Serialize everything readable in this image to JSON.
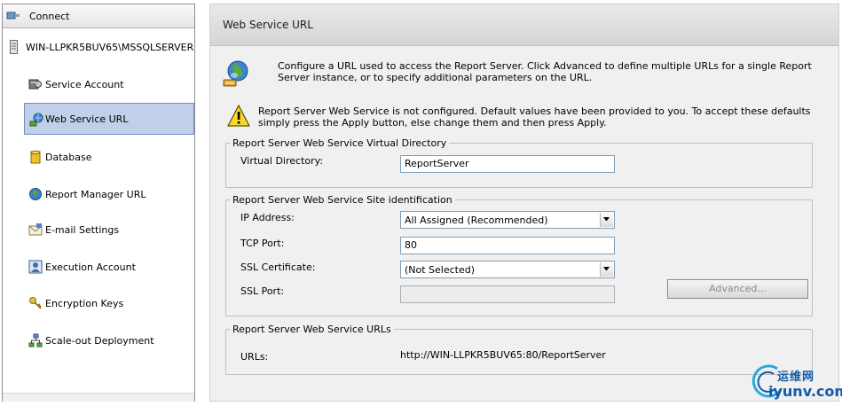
{
  "nav": {
    "connect_label": "Connect",
    "server_label": "WIN-LLPKR5BUV65\\MSSQLSERVER",
    "items": [
      {
        "label": "Service Account",
        "icon": "service-account-icon"
      },
      {
        "label": "Web Service URL",
        "icon": "web-service-url-icon",
        "selected": true
      },
      {
        "label": "Database",
        "icon": "database-icon"
      },
      {
        "label": "Report Manager URL",
        "icon": "globe-icon"
      },
      {
        "label": "E-mail Settings",
        "icon": "envelope-icon"
      },
      {
        "label": "Execution Account",
        "icon": "user-account-icon"
      },
      {
        "label": "Encryption Keys",
        "icon": "keys-icon"
      },
      {
        "label": "Scale-out Deployment",
        "icon": "network-icon"
      }
    ]
  },
  "page": {
    "title": "Web Service URL",
    "intro": "Configure a URL used to access the Report Server.  Click Advanced to define multiple URLs for a single Report Server instance, or to specify additional parameters on the URL.",
    "warning": "Report Server Web Service is not configured. Default values have been provided to you. To accept these defaults simply press the Apply button, else change them and then press Apply."
  },
  "virtual_directory": {
    "legend": "Report Server Web Service Virtual Directory",
    "label": "Virtual Directory:",
    "value": "ReportServer"
  },
  "site_identification": {
    "legend": "Report Server Web Service Site identification",
    "ip_label": "IP Address:",
    "ip_value": "All Assigned (Recommended)",
    "tcp_label": "TCP Port:",
    "tcp_value": "80",
    "ssl_cert_label": "SSL Certificate:",
    "ssl_cert_value": "(Not Selected)",
    "ssl_port_label": "SSL Port:",
    "ssl_port_value": "",
    "advanced_label": "Advanced..."
  },
  "urls": {
    "legend": "Report Server Web Service URLs",
    "label": "URLs:",
    "value": "http://WIN-LLPKR5BUV65:80/ReportServer"
  },
  "watermark": {
    "cn": "运维网",
    "en": "iyunv.com"
  },
  "colors": {
    "selection": "#c0d0e8",
    "selection_border": "#6c8fc4",
    "pane_background": "#f0f0f0"
  }
}
